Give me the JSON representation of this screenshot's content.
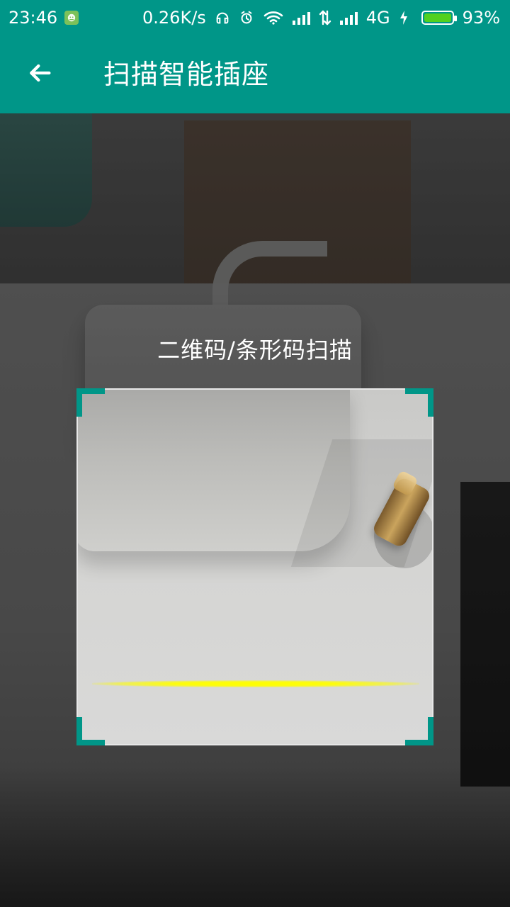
{
  "status_bar": {
    "time": "23:46",
    "network_speed": "0.26K/s",
    "network_type": "4G",
    "battery_percent": "93%",
    "icons": [
      "android-app-icon",
      "headphones-icon",
      "alarm-icon",
      "wifi-icon",
      "signal-icon",
      "data-transfer-icon",
      "signal-icon",
      "charging-icon",
      "battery-icon"
    ]
  },
  "app_bar": {
    "title": "扫描智能插座",
    "back_icon": "arrow-back-icon",
    "background_color": "#009688"
  },
  "scanner": {
    "hint": "二维码/条形码扫描",
    "frame_corner_color": "#009688",
    "scan_line_color": "#FFFF00"
  }
}
